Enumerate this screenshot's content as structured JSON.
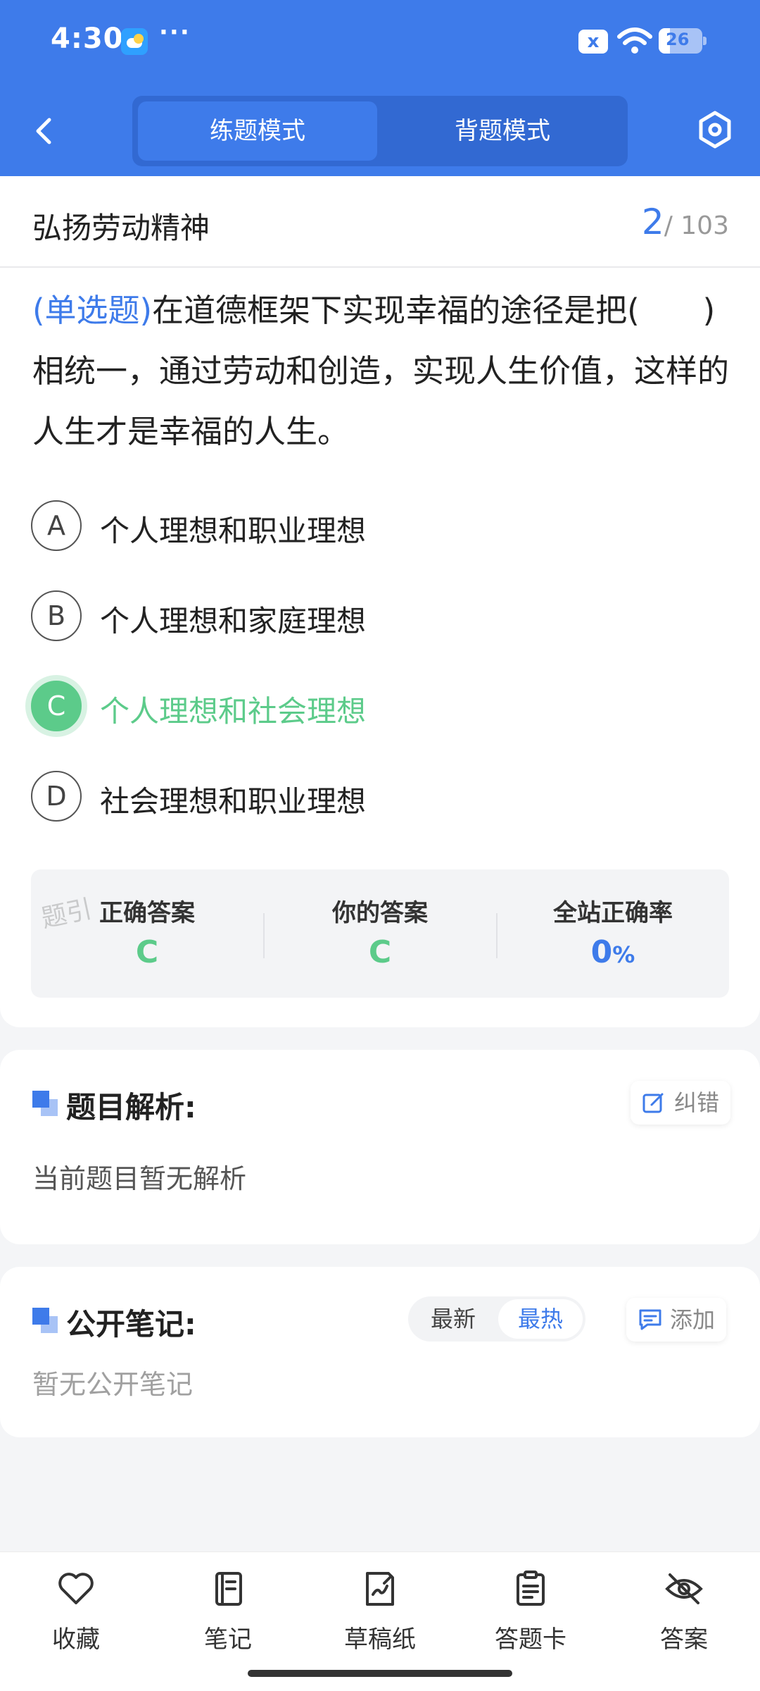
{
  "status_bar": {
    "time": "4:30",
    "more_dots": "···",
    "sim_icon_label": "x",
    "battery_level": "26"
  },
  "header": {
    "back_icon": "chevron-left-icon",
    "tabs": [
      {
        "label": "练题模式",
        "active": true
      },
      {
        "label": "背题模式",
        "active": false
      }
    ],
    "settings_icon": "hexagon-settings-icon"
  },
  "question": {
    "chapter_title": "弘扬劳动精神",
    "current_index": "2",
    "total_label": "/ 103",
    "type_label": "(单选题)",
    "stem": "在道德框架下实现幸福的途径是把(　　)相统一，通过劳动和创造，实现人生价值，这样的人生才是幸福的人生。",
    "options": [
      {
        "letter": "A",
        "text": "个人理想和职业理想",
        "selected": false
      },
      {
        "letter": "B",
        "text": "个人理想和家庭理想",
        "selected": false
      },
      {
        "letter": "C",
        "text": "个人理想和社会理想",
        "selected": true
      },
      {
        "letter": "D",
        "text": "社会理想和职业理想",
        "selected": false
      }
    ]
  },
  "answer_summary": {
    "watermark": "题引",
    "correct_label": "正确答案",
    "correct_value": "C",
    "yours_label": "你的答案",
    "yours_value": "C",
    "rate_label": "全站正确率",
    "rate_value": "0",
    "rate_unit": "%"
  },
  "analysis": {
    "title": "题目解析:",
    "report_button": "纠错",
    "content": "当前题目暂无解析"
  },
  "notes": {
    "title": "公开笔记:",
    "sort_options": [
      "最新",
      "最热"
    ],
    "sort_selected": "最热",
    "add_button": "添加",
    "empty_text": "暂无公开笔记"
  },
  "bottom_nav": [
    {
      "label": "收藏",
      "icon": "heart-icon"
    },
    {
      "label": "笔记",
      "icon": "notebook-icon"
    },
    {
      "label": "草稿纸",
      "icon": "draft-paper-icon"
    },
    {
      "label": "答题卡",
      "icon": "answer-card-icon"
    },
    {
      "label": "答案",
      "icon": "eye-off-icon"
    }
  ],
  "colors": {
    "primary": "#3e7bea",
    "correct": "#5ccb8a",
    "background": "#f4f5f7"
  }
}
